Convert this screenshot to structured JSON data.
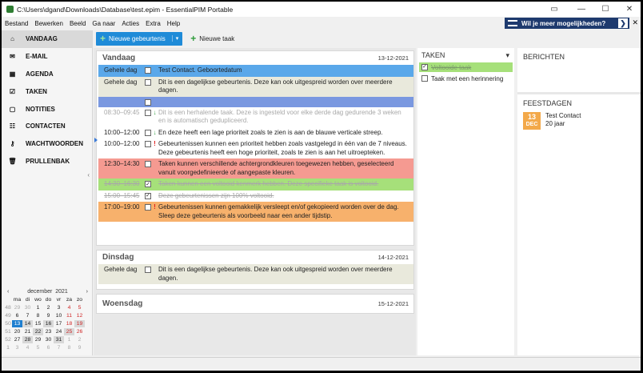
{
  "window": {
    "title": "C:\\Users\\dgand\\Downloads\\Database\\test.epim - EssentialPIM Portable"
  },
  "menu": [
    "Bestand",
    "Bewerken",
    "Beeld",
    "Ga naar",
    "Acties",
    "Extra",
    "Help"
  ],
  "promo": {
    "label": "Wil je meer mogelijkheden?"
  },
  "nav": [
    {
      "label": "VANDAAG",
      "icon": "home-icon",
      "active": true
    },
    {
      "label": "E-MAIL",
      "icon": "email-icon"
    },
    {
      "label": "AGENDA",
      "icon": "calendar-icon"
    },
    {
      "label": "TAKEN",
      "icon": "tasks-icon"
    },
    {
      "label": "NOTITIES",
      "icon": "notes-icon"
    },
    {
      "label": "CONTACTEN",
      "icon": "contacts-icon"
    },
    {
      "label": "WACHTWOORDEN",
      "icon": "key-icon"
    },
    {
      "label": "PRULLENBAK",
      "icon": "trash-icon"
    }
  ],
  "toolbar": {
    "new_event": "Nieuwe gebeurtenis",
    "new_task": "Nieuwe taak"
  },
  "today": {
    "name": "Vandaag",
    "date": "13-12-2021",
    "events": [
      {
        "time": "Gehele dag",
        "text": "Test Contact. Geboortedatum",
        "bg": "#5aa8ea",
        "cb": ""
      },
      {
        "time": "Gehele dag",
        "text": "Dit is een dagelijkse gebeurtenis. Deze kan ook uitgespreid worden over meerdere dagen.",
        "bg": "#e9e9dc",
        "cb": ""
      },
      {
        "time": "",
        "text": "",
        "bg": "#7a98e0",
        "cb": ""
      },
      {
        "time": "08:30–09:45",
        "text": "Dit is een herhalende taak. Deze is ingesteld voor elke derde dag gedurende 3 weken en is automatisch gedupliceerd.",
        "bg": "#ffffff",
        "cb": "",
        "mark": "↓",
        "markColor": "#3aa04a",
        "muted": true
      },
      {
        "time": "10:00–12:00",
        "text": "En deze heeft een lage prioriteit zoals te zien is aan de blauwe verticale streep.",
        "bg": "#ffffff",
        "cb": "",
        "mark": "↓",
        "markColor": "#3aa04a"
      },
      {
        "time": "10:00–12:00",
        "text": "Gebeurtenissen kunnen een prioriteit hebben zoals vastgelegd in één van de 7 niveaus. Deze gebeurtenis heeft een hoge prioriteit, zoals te zien is aan het uitroepteken.",
        "bg": "#ffffff",
        "cb": "",
        "mark": "!",
        "markColor": "#e02020"
      },
      {
        "time": "12:30–14:30",
        "text": "Taken kunnen verschillende achtergrondkleuren toegewezen hebben, geselecteerd vanuit voorgedefinieerde of aangepaste kleuren.",
        "bg": "#f59a91",
        "cb": ""
      },
      {
        "time": "14:30–16:30",
        "text": "Taken kunnen een voltooid kenmerk hebben. Deze specifieke taak is voltooid.",
        "bg": "#a6e07a",
        "cb": "✓",
        "strike": true,
        "muted": true
      },
      {
        "time": "15:00–15:45",
        "text": "Deze gebeurtenissen zijn 100% voltooid.",
        "bg": "#ffffff",
        "cb": "✓",
        "strike": true,
        "muted": true
      },
      {
        "time": "17:00–19:00",
        "text": "Gebeurtenissen kunnen gemakkelijk versleept en/of gekopieerd worden over de dag. Sleep deze gebeurtenis als voorbeeld naar een ander tijdstip.",
        "bg": "#f7b16c",
        "cb": "",
        "mark": "!",
        "markColor": "#e02020"
      }
    ]
  },
  "tuesday": {
    "name": "Dinsdag",
    "date": "14-12-2021",
    "events": [
      {
        "time": "Gehele dag",
        "text": "Dit is een dagelijkse gebeurtenis. Deze kan ook uitgespreid worden over meerdere dagen.",
        "bg": "#e9e9dc"
      }
    ]
  },
  "wednesday": {
    "name": "Woensdag",
    "date": "15-12-2021"
  },
  "tasks": {
    "header": "TAKEN",
    "items": [
      {
        "label": "Voltooide taak",
        "done": true,
        "bg": "#a6e07a"
      },
      {
        "label": "Taak met een herinnering",
        "done": false,
        "bg": "#ffffff"
      }
    ]
  },
  "messages": {
    "header": "BERICHTEN"
  },
  "holidays": {
    "header": "FEESTDAGEN",
    "day": "13",
    "month": "DEC",
    "name": "Test Contact",
    "age": "20 jaar"
  },
  "calendar": {
    "month": "december",
    "year": "2021",
    "prev": "‹",
    "next": "›",
    "weekdays": [
      "ma",
      "di",
      "wo",
      "do",
      "vr",
      "za",
      "zo"
    ],
    "weeks": [
      {
        "wk": "48",
        "days": [
          "29",
          "30",
          "1",
          "2",
          "3",
          "4",
          "5"
        ]
      },
      {
        "wk": "49",
        "days": [
          "6",
          "7",
          "8",
          "9",
          "10",
          "11",
          "12"
        ]
      },
      {
        "wk": "50",
        "days": [
          "13",
          "14",
          "15",
          "16",
          "17",
          "18",
          "19"
        ]
      },
      {
        "wk": "51",
        "days": [
          "20",
          "21",
          "22",
          "23",
          "24",
          "25",
          "26"
        ]
      },
      {
        "wk": "52",
        "days": [
          "27",
          "28",
          "29",
          "30",
          "31",
          "1",
          "2"
        ]
      },
      {
        "wk": "1",
        "days": [
          "3",
          "4",
          "5",
          "6",
          "7",
          "8",
          "9"
        ]
      }
    ],
    "today_color": "#1f7fd0",
    "weekend_color": "#d02828"
  }
}
